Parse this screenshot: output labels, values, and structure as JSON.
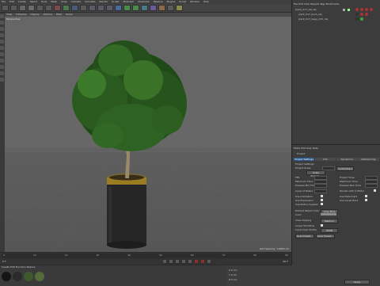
{
  "menubar": {
    "items": [
      "File",
      "Edit",
      "Create",
      "Select",
      "Tools",
      "Mesh",
      "Snap",
      "Animate",
      "Simulate",
      "Render",
      "Sculpt",
      "MoGraph",
      "Character",
      "Pipeline",
      "Plugins",
      "Script",
      "Window",
      "Help"
    ]
  },
  "viewport": {
    "menu": [
      "View",
      "Cameras",
      "Display",
      "Options",
      "Filter",
      "Panel"
    ],
    "camera_label": "Perspective",
    "grid_spacing": "Grid Spacing : 10000 cm"
  },
  "timeline": {
    "frame_start": "0 F",
    "frame_end": "90 F",
    "ticks": [
      "0",
      "5",
      "10",
      "15",
      "20",
      "25",
      "30",
      "35",
      "40",
      "45",
      "50",
      "55",
      "60",
      "65",
      "70",
      "75",
      "80",
      "85",
      "90"
    ]
  },
  "materials": {
    "menu": [
      "Create",
      "Edit",
      "Function",
      "Texture"
    ],
    "swatch_colors": [
      "#1e1e1e",
      "#2f2f2f",
      "#3f5a2a",
      "#556b3a",
      "#6b5a3a",
      "#444"
    ]
  },
  "coords": {
    "x": "0 cm",
    "y": "0 cm",
    "z": "0 cm",
    "apply": "Apply"
  },
  "object_manager": {
    "menu": [
      "File",
      "Edit",
      "View",
      "Objects",
      "Tags",
      "Bookmarks"
    ],
    "objects": [
      {
        "name": "plant_017_obj.obj"
      },
      {
        "name": "plant_017_bush_obj"
      },
      {
        "name": "plant_017_bags_mtrl_obj"
      }
    ]
  },
  "attribute_manager": {
    "menu": [
      "Mode",
      "Edit",
      "User Data"
    ],
    "title": "Project",
    "tabs": [
      "Project Settings",
      "Info",
      "Dynamics",
      "Referencing"
    ],
    "section": "Project Settings",
    "fields": [
      {
        "label": "Project Scale",
        "value": "1",
        "unit": "Centimeters"
      },
      {
        "label": "FPS",
        "value": "30"
      },
      {
        "label": "Project Time",
        "value": "0 F"
      },
      {
        "label": "Minimum Time",
        "value": "0 F"
      },
      {
        "label": "Maximum Time",
        "value": "90 F"
      },
      {
        "label": "Preview Min Time",
        "value": "0 F"
      },
      {
        "label": "Preview Max Time",
        "value": "90 F"
      },
      {
        "label": "Level of Detail",
        "value": "100 %"
      },
      {
        "label": "Render LOD in Editor",
        "value": ""
      }
    ],
    "checks": [
      "Use Animation",
      "Use Expression",
      "Use Generators",
      "Use Deformers",
      "Use Motion System"
    ],
    "color_rows": [
      {
        "label": "Default Object Color",
        "value": "Gray Blue"
      },
      {
        "label": "Color",
        "value": ""
      },
      {
        "label": "View Clipping",
        "value": "Medium"
      },
      {
        "label": "Linear Workflow",
        "value": ""
      },
      {
        "label": "Input Color Profile",
        "value": "sRGB"
      }
    ],
    "buttons": [
      "Load Preset...",
      "Save Preset..."
    ],
    "scale_button": "Scale Project..."
  }
}
